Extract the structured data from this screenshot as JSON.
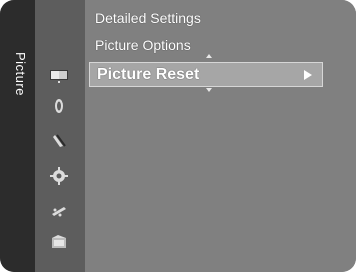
{
  "menu": {
    "category": "Picture",
    "items": [
      {
        "label": "Detailed Settings"
      },
      {
        "label": "Picture Options"
      },
      {
        "label": "Picture Reset"
      }
    ],
    "selected_index": 2
  },
  "icons": [
    "picture-icon",
    "sound-icon",
    "channel-icon",
    "setup-icon",
    "input-icon",
    "application-icon"
  ]
}
